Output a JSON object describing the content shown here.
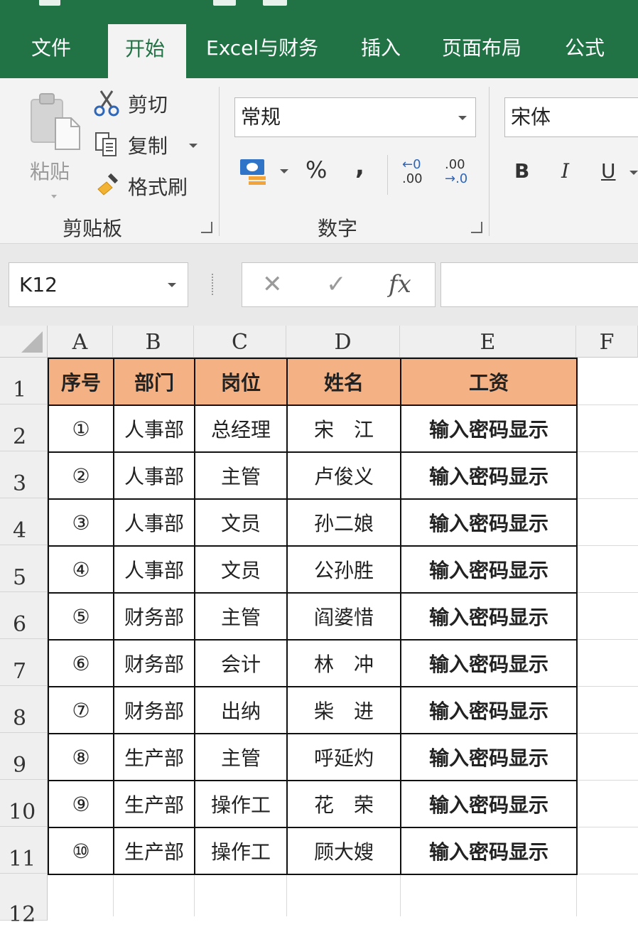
{
  "ribbon_tabs": [
    "文件",
    "开始",
    "Excel与财务",
    "插入",
    "页面布局",
    "公式"
  ],
  "active_tab": "开始",
  "clipboard": {
    "paste": "粘贴",
    "cut": "剪切",
    "copy": "复制",
    "format_painter": "格式刷",
    "group_label": "剪贴板"
  },
  "number": {
    "format_value": "常规",
    "percent": "%",
    "comma": ",",
    "increase_decimal_top": "←0",
    "increase_decimal_bottom": ".00",
    "decrease_decimal_top": ".00",
    "decrease_decimal_bottom": "→.0",
    "group_label": "数字"
  },
  "font": {
    "font_name": "宋体",
    "bold": "B",
    "italic": "I",
    "underline": "U"
  },
  "formula_bar": {
    "name_box": "K12",
    "cancel": "✕",
    "enter": "✓",
    "fx": "fx",
    "formula": ""
  },
  "columns": [
    "A",
    "B",
    "C",
    "D",
    "E",
    "F"
  ],
  "row_numbers": [
    "1",
    "2",
    "3",
    "4",
    "5",
    "6",
    "7",
    "8",
    "9",
    "10",
    "11",
    "12"
  ],
  "table": {
    "headers": [
      "序号",
      "部门",
      "岗位",
      "姓名",
      "工资"
    ],
    "rows": [
      [
        "①",
        "人事部",
        "总经理",
        "宋　江",
        "输入密码显示"
      ],
      [
        "②",
        "人事部",
        "主管",
        "卢俊义",
        "输入密码显示"
      ],
      [
        "③",
        "人事部",
        "文员",
        "孙二娘",
        "输入密码显示"
      ],
      [
        "④",
        "人事部",
        "文员",
        "公孙胜",
        "输入密码显示"
      ],
      [
        "⑤",
        "财务部",
        "主管",
        "阎婆惜",
        "输入密码显示"
      ],
      [
        "⑥",
        "财务部",
        "会计",
        "林　冲",
        "输入密码显示"
      ],
      [
        "⑦",
        "财务部",
        "出纳",
        "柴　进",
        "输入密码显示"
      ],
      [
        "⑧",
        "生产部",
        "主管",
        "呼延灼",
        "输入密码显示"
      ],
      [
        "⑨",
        "生产部",
        "操作工",
        "花　荣",
        "输入密码显示"
      ],
      [
        "⑩",
        "生产部",
        "操作工",
        "顾大嫂",
        "输入密码显示"
      ]
    ]
  },
  "colors": {
    "excel_green": "#217346",
    "header_fill": "#f4b183",
    "salary_text": "#e00000",
    "seq_text": "#1a3fbf"
  }
}
